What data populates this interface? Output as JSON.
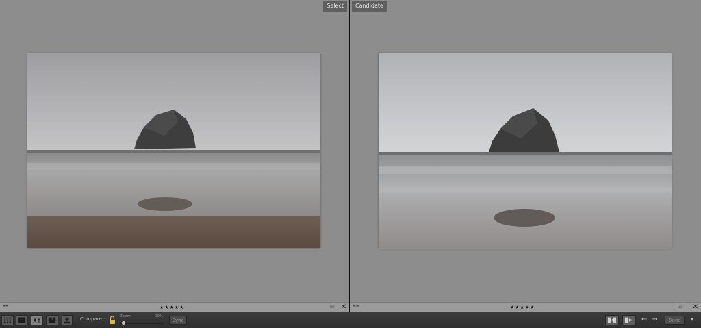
{
  "panes": {
    "select": {
      "label": "Select",
      "rating": "★★★★★"
    },
    "candidate": {
      "label": "Candidate",
      "rating": "★★★★★"
    }
  },
  "rating_bar": {
    "close": "✕",
    "flag": "⚑⚑",
    "mini": "▯▯"
  },
  "toolbar": {
    "compare_label": "Compare :",
    "zoom_label": "Zoom",
    "zoom_value": "99%",
    "zoom_level_fraction": 0.03,
    "sync_label": "Sync",
    "left_arrow": "←",
    "right_arrow": "→",
    "done_label": "Done",
    "menu": "▾"
  },
  "icons": {
    "grid": "grid-view-icon",
    "loupe": "loupe-view-icon",
    "compare": "compare-view-icon",
    "survey": "survey-view-icon",
    "people": "people-view-icon",
    "lock": "lock-icon",
    "swap": "swap-icon",
    "make_select": "make-select-icon"
  },
  "colors": {
    "pane_bg": "#8d8d8d",
    "toolbar_bg": "#333333",
    "lock_gold": "#d2b45a"
  }
}
